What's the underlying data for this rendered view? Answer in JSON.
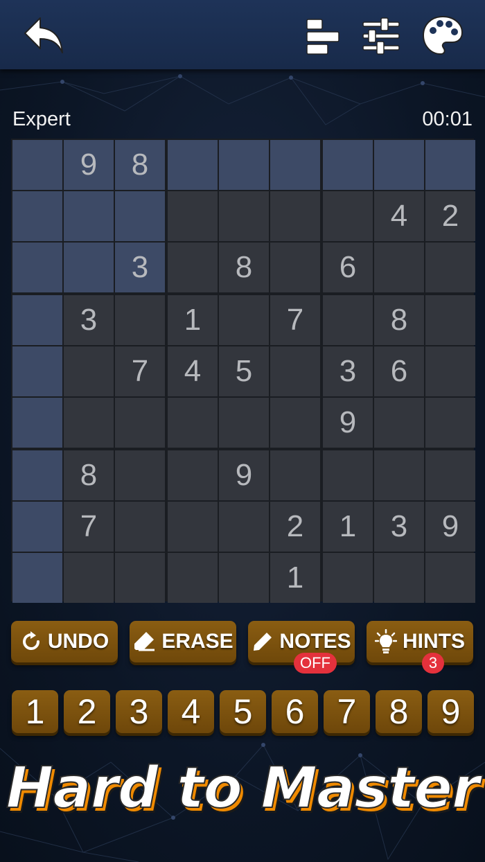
{
  "header": {
    "back_icon": "undo-arrow-icon",
    "icons": [
      "leaderboard-icon",
      "settings-sliders-icon",
      "theme-palette-icon"
    ]
  },
  "game": {
    "level": "Expert",
    "timer": "00:01"
  },
  "board": {
    "rows": [
      [
        "",
        "9",
        "8",
        "",
        "",
        "",
        "",
        "",
        ""
      ],
      [
        "",
        "",
        "",
        "",
        "",
        "",
        "",
        "4",
        "2"
      ],
      [
        "",
        "",
        "3",
        "",
        "8",
        "",
        "6",
        "",
        ""
      ],
      [
        "",
        "3",
        "",
        "1",
        "",
        "7",
        "",
        "8",
        ""
      ],
      [
        "",
        "",
        "7",
        "4",
        "5",
        "",
        "3",
        "6",
        ""
      ],
      [
        "",
        "",
        "",
        "",
        "",
        "",
        "9",
        "",
        ""
      ],
      [
        "",
        "8",
        "",
        "",
        "9",
        "",
        "",
        "",
        ""
      ],
      [
        "",
        "7",
        "",
        "",
        "",
        "2",
        "1",
        "3",
        "9"
      ],
      [
        "",
        "",
        "",
        "",
        "",
        "1",
        "",
        "",
        ""
      ]
    ],
    "selected_cell": {
      "row": 0,
      "col": 0
    }
  },
  "tools": {
    "undo": "UNDO",
    "erase": "ERASE",
    "notes": "NOTES",
    "notes_state": "OFF",
    "hints": "HINTS",
    "hints_count": "3"
  },
  "numbers": [
    "1",
    "2",
    "3",
    "4",
    "5",
    "6",
    "7",
    "8",
    "9"
  ],
  "slogan": "Hard to Master",
  "colors": {
    "header": "#1e3358",
    "highlight": "#3d4a66",
    "cell": "#33363d",
    "button": "#7d540f",
    "badge": "#e4313c",
    "slogan_shadow": "#f08a00"
  }
}
